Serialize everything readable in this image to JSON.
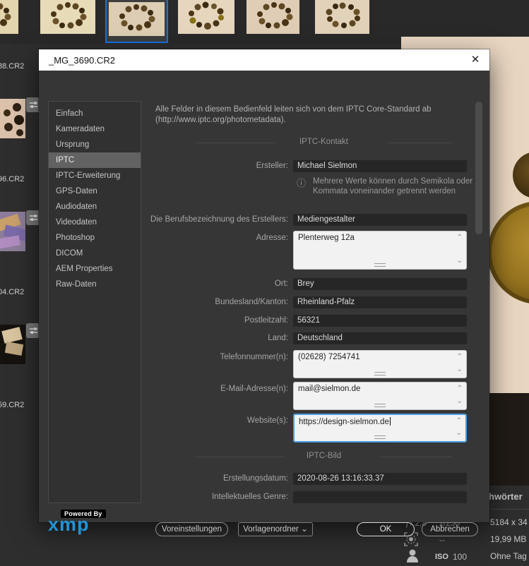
{
  "dialog": {
    "title": "_MG_3690.CR2",
    "description_line1": "Alle Felder in diesem Bedienfeld leiten sich von dem IPTC Core-Standard ab",
    "description_line2": "(http://www.iptc.org/photometadata).",
    "sidebar": {
      "items": [
        "Einfach",
        "Kameradaten",
        "Ursprung",
        "IPTC",
        "IPTC-Erweiterung",
        "GPS-Daten",
        "Audiodaten",
        "Videodaten",
        "Photoshop",
        "DICOM",
        "AEM Properties",
        "Raw-Daten"
      ],
      "selected": "IPTC"
    },
    "section_contact": "IPTC-Kontakt",
    "section_image": "IPTC-Bild",
    "info_note_line1": "Mehrere Werte können durch Semikola oder",
    "info_note_line2": "Kommata voneinander getrennt werden",
    "rows": [
      {
        "label": "Ersteller:",
        "value": "Michael Sielmon"
      },
      {
        "label": "Die Berufsbezeichnung des Erstellers:",
        "value": "Mediengestalter"
      },
      {
        "label": "Adresse:",
        "value": "Plenterweg 12a"
      },
      {
        "label": "Ort:",
        "value": "Brey"
      },
      {
        "label": "Bundesland/Kanton:",
        "value": "Rheinland-Pfalz"
      },
      {
        "label": "Postleitzahl:",
        "value": "56321"
      },
      {
        "label": "Land:",
        "value": "Deutschland"
      },
      {
        "label": "Telefonnummer(n):",
        "value": "(02628) 7254741"
      },
      {
        "label": "E-Mail-Adresse(n):",
        "value": "mail@sielmon.de"
      },
      {
        "label": "Website(s):",
        "value": "https://design-sielmon.de"
      },
      {
        "label": "Erstellungsdatum:",
        "value": "2020-08-26 13:16:33.37"
      },
      {
        "label": "Intellektuelles Genre:",
        "value": ""
      }
    ],
    "footer": {
      "powered_by": "Powered By",
      "xmp": "xmp",
      "presets_button": "Voreinstellungen",
      "template_folder_button": "Vorlagenordner",
      "ok_button": "OK",
      "cancel_button": "Abbrechen"
    }
  },
  "icons": {
    "close": "✕",
    "info": "ⓘ",
    "chevron_up": "⌃",
    "chevron_down": "⌄",
    "dropdown_caret": "⌄"
  },
  "background": {
    "filmstrip_labels": [
      "88.CR2",
      "96.CR2",
      "04.CR2",
      "59.CR2"
    ],
    "metadata_panel": {
      "tab_label": "hwörter",
      "aperture": "ƒ/ 2,8",
      "shutter": "1/250",
      "flash": "--",
      "iso_label": "ISO",
      "iso_value": "100",
      "dimensions": "5184 x 34",
      "file_size": "19,99 MB",
      "label_status": "Ohne Tag"
    }
  },
  "colors": {
    "selection_blue": "#1473e6",
    "focus_blue": "#4b9fe6",
    "xmp_blue": "#2293d6"
  }
}
